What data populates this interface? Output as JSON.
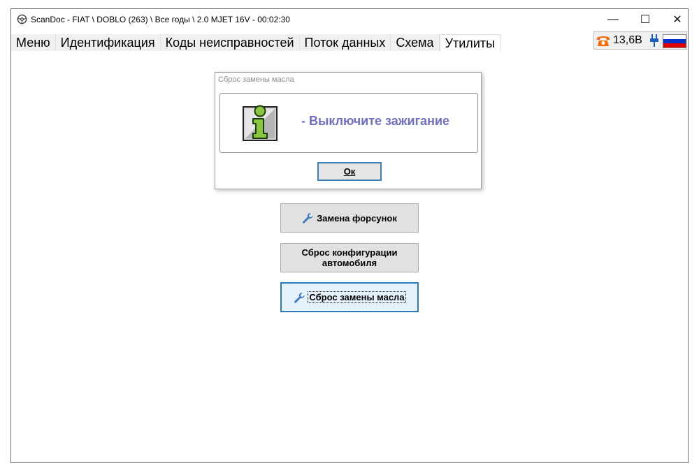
{
  "window": {
    "title": "ScanDoc - FIAT \\ DOBLO (263) \\ Все годы \\ 2.0 MJET 16V - 00:02:30",
    "controls": {
      "minimize": "—",
      "maximize": "☐",
      "close": "✕"
    }
  },
  "menu": {
    "items": [
      {
        "label": "Меню"
      },
      {
        "label": "Идентификация"
      },
      {
        "label": "Коды неисправностей"
      },
      {
        "label": "Поток данных"
      },
      {
        "label": "Схема"
      },
      {
        "label": "Утилиты",
        "active": true
      }
    ]
  },
  "status": {
    "voltage": "13,6В",
    "icons": [
      "phone-icon",
      "plug-icon",
      "russian-flag-icon"
    ],
    "flag_colors": [
      "#ffffff",
      "#0033cc",
      "#e00000"
    ]
  },
  "dialog": {
    "title": "Сброс замены масла",
    "message": "- Выключите зажигание",
    "ok_label": "Ок",
    "icon": "info-icon"
  },
  "utilities": {
    "buttons": [
      {
        "label": "Замена форсунок",
        "icon": "wrench-icon"
      },
      {
        "label": "Сброс конфигурации автомобиля"
      },
      {
        "label": "Сброс замены масла",
        "icon": "wrench-icon",
        "focused": true
      }
    ]
  },
  "colors": {
    "accent_blue": "#2f7bbf",
    "message_text": "#6f6fc8",
    "phone_orange": "#ff6600",
    "info_green": "#8bc540"
  }
}
